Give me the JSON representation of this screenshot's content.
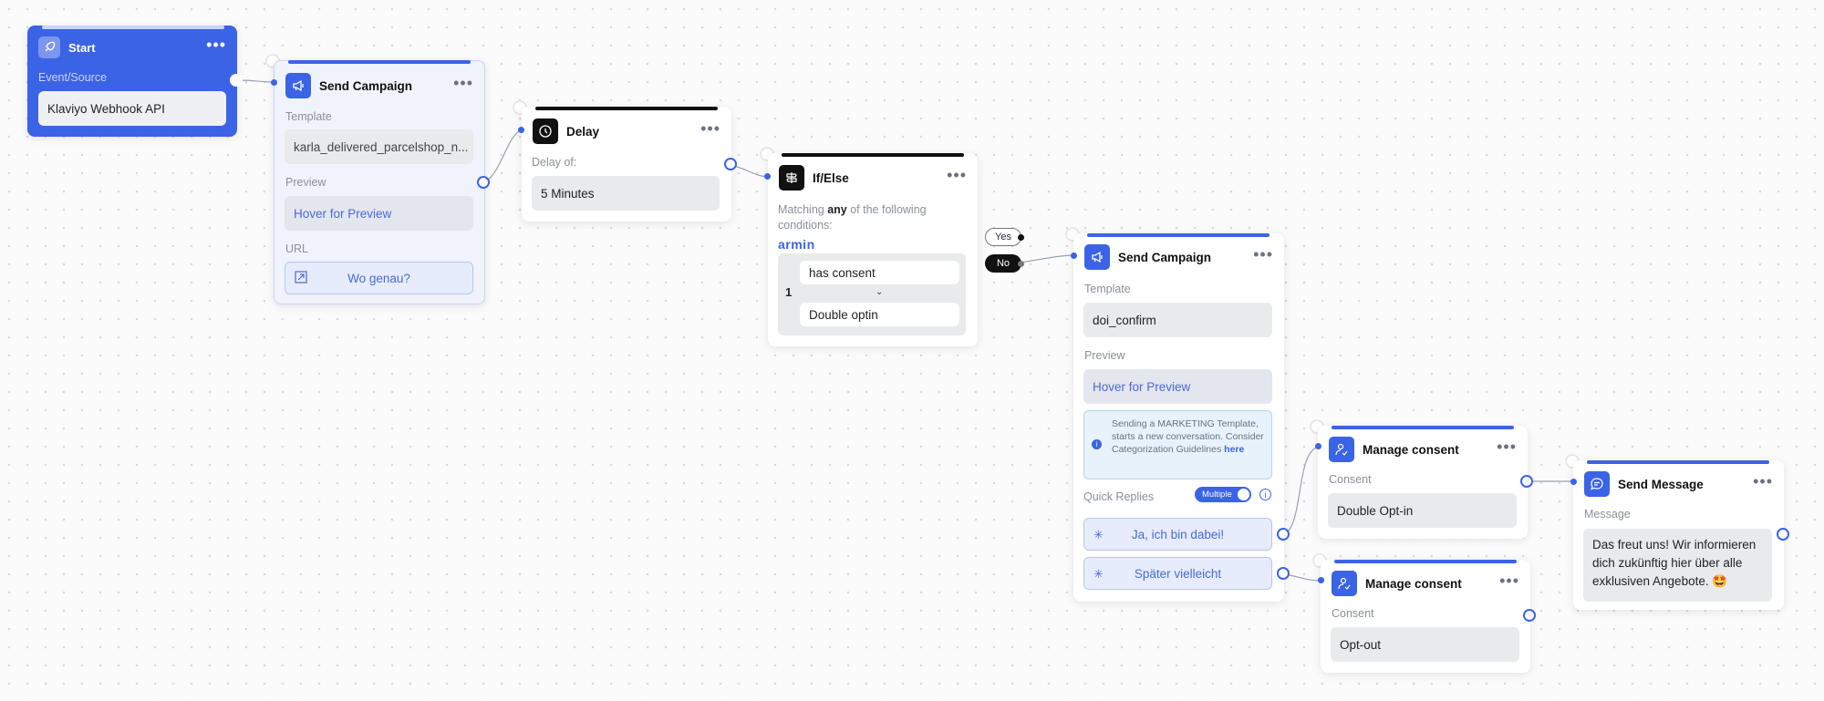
{
  "start": {
    "title": "Start",
    "label": "Event/Source",
    "value": "Klaviyo Webhook API"
  },
  "campaign1": {
    "title": "Send Campaign",
    "template_label": "Template",
    "template_value": "karla_delivered_parcelshop_n...",
    "preview_label": "Preview",
    "preview_value": "Hover for Preview",
    "url_label": "URL",
    "url_value": "Wo genau?"
  },
  "delay": {
    "title": "Delay",
    "label": "Delay of:",
    "value": "5 Minutes"
  },
  "ifelse": {
    "title": "If/Else",
    "matching_prefix": "Matching ",
    "matching_bold": "any",
    "matching_suffix": " of the following conditions:",
    "brand": "armin",
    "row_number": "1",
    "condition_1": "has consent",
    "condition_2": "Double optin",
    "yes_label": "Yes",
    "no_label": "No"
  },
  "campaign2": {
    "title": "Send Campaign",
    "template_label": "Template",
    "template_value": "doi_confirm",
    "preview_label": "Preview",
    "preview_value": "Hover for Preview",
    "info_text": "Sending a MARKETING Template, starts a new conversation. Consider Categorization Guidelines ",
    "info_link": "here",
    "quick_replies_label": "Quick Replies",
    "multiple_label": "Multiple",
    "reply_1": "Ja, ich bin dabei!",
    "reply_2": "Später vielleicht"
  },
  "consent1": {
    "title": "Manage consent",
    "label": "Consent",
    "value": "Double Opt-in"
  },
  "consent2": {
    "title": "Manage consent",
    "label": "Consent",
    "value": "Opt-out"
  },
  "message": {
    "title": "Send Message",
    "label": "Message",
    "value": "Das freut uns! Wir informieren dich zukünftig hier über alle exklusiven Angebote. 🤩"
  },
  "colors": {
    "accent": "#3b63e6",
    "start_bg": "#3b63e6",
    "canvas_bg": "#fbfbfc"
  }
}
